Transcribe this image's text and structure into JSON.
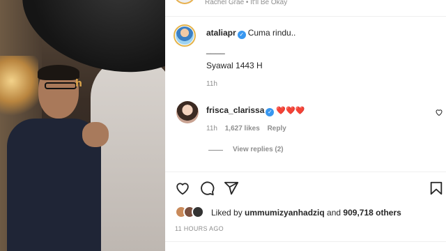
{
  "post": {
    "song": {
      "text": "Rachel Grae • It'll Be Okay"
    },
    "caption": {
      "username": "ataliapr",
      "verified_mark": "✓",
      "text": "Cuma rindu..",
      "separator": "____",
      "line2": "Syawal 1443 H",
      "time": "11h"
    },
    "comments": [
      {
        "username": "frisca_clarissa",
        "verified_mark": "✓",
        "text": "❤️❤️❤️",
        "time": "11h",
        "likes": "1,627 likes",
        "reply_label": "Reply",
        "view_replies": "View replies (2)"
      }
    ],
    "liked_by": {
      "prefix": "Liked by ",
      "user": "ummumizyanhadziq",
      "middle": " and ",
      "count": "909,718 others"
    },
    "timestamp": "11 HOURS AGO"
  },
  "photo": {
    "sign_text": "h"
  },
  "colors": {
    "verified": "#3897f0",
    "heart": "#ed4956",
    "muted": "#8e8e8e",
    "text": "#262626"
  },
  "icons": [
    "heart-icon",
    "comment-icon",
    "share-icon",
    "bookmark-icon",
    "comment-like-icon"
  ]
}
